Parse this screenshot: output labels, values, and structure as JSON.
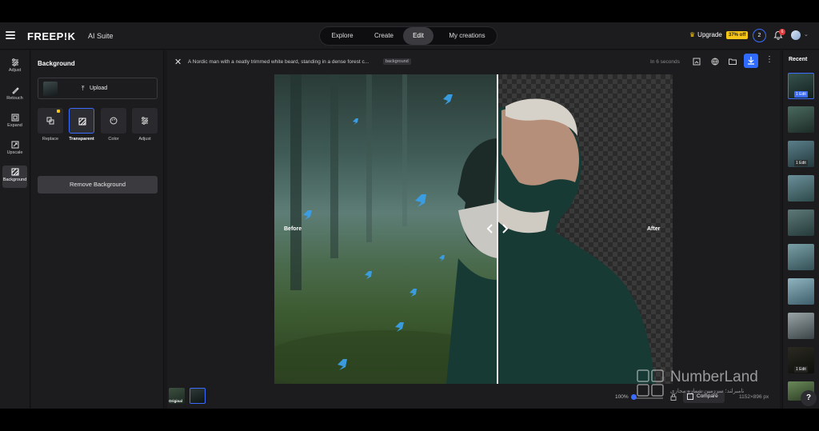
{
  "header": {
    "logo": "FREEP!K",
    "suite": "AI Suite",
    "nav": [
      "Explore",
      "Create",
      "Edit",
      "My creations"
    ],
    "active_nav": "Edit",
    "upgrade_label": "Upgrade",
    "discount": "37% off",
    "credits": "2",
    "notification_count": "6"
  },
  "rail": {
    "tools": [
      {
        "label": "Adjust",
        "icon": "sliders-icon"
      },
      {
        "label": "Retouch",
        "icon": "brush-icon"
      },
      {
        "label": "Expand",
        "icon": "expand-icon"
      },
      {
        "label": "Upscale",
        "icon": "upscale-icon"
      },
      {
        "label": "Background",
        "icon": "background-icon"
      }
    ],
    "active": "Background"
  },
  "panel": {
    "title": "Background",
    "upload_label": "Upload",
    "options": [
      {
        "label": "Replace"
      },
      {
        "label": "Transparent"
      },
      {
        "label": "Color"
      },
      {
        "label": "Adjust"
      }
    ],
    "selected_option": "Transparent",
    "remove_label": "Remove Background"
  },
  "main": {
    "prompt": "A Nordic man with a neatly trimmed white beard, standing in a dense forest c...",
    "tag": "background",
    "time": "In 6 seconds",
    "before_label": "Before",
    "after_label": "After",
    "original_label": "Original",
    "zoom": "100%",
    "compare_label": "Compare",
    "dimensions": "1152×896 px"
  },
  "recent": {
    "title": "Recent",
    "edit_label": "1 Edit"
  },
  "watermark": {
    "name": "NumberLand",
    "subtitle": "نامبرلند؛ سرزمین شماره مجازی"
  },
  "colors": {
    "accent": "#3b6cff",
    "badge": "#f5c518",
    "panel_bg": "#1c1c1f"
  }
}
